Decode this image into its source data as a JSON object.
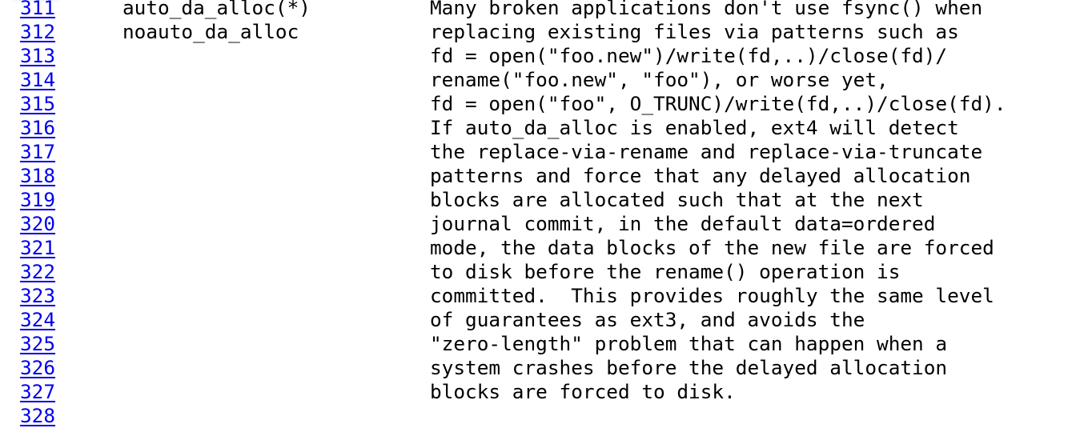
{
  "lines": [
    {
      "number": "311",
      "option": "auto_da_alloc(*)",
      "text": "Many broken applications don't use fsync() when"
    },
    {
      "number": "312",
      "option": "noauto_da_alloc",
      "text": "replacing existing files via patterns such as"
    },
    {
      "number": "313",
      "option": "",
      "text": "fd = open(\"foo.new\")/write(fd,..)/close(fd)/"
    },
    {
      "number": "314",
      "option": "",
      "text": "rename(\"foo.new\", \"foo\"), or worse yet,"
    },
    {
      "number": "315",
      "option": "",
      "text": "fd = open(\"foo\", O_TRUNC)/write(fd,..)/close(fd)."
    },
    {
      "number": "316",
      "option": "",
      "text": "If auto_da_alloc is enabled, ext4 will detect"
    },
    {
      "number": "317",
      "option": "",
      "text": "the replace-via-rename and replace-via-truncate"
    },
    {
      "number": "318",
      "option": "",
      "text": "patterns and force that any delayed allocation"
    },
    {
      "number": "319",
      "option": "",
      "text": "blocks are allocated such that at the next"
    },
    {
      "number": "320",
      "option": "",
      "text": "journal commit, in the default data=ordered"
    },
    {
      "number": "321",
      "option": "",
      "text": "mode, the data blocks of the new file are forced"
    },
    {
      "number": "322",
      "option": "",
      "text": "to disk before the rename() operation is"
    },
    {
      "number": "323",
      "option": "",
      "text": "committed.  This provides roughly the same level"
    },
    {
      "number": "324",
      "option": "",
      "text": "of guarantees as ext3, and avoids the"
    },
    {
      "number": "325",
      "option": "",
      "text": "\"zero-length\" problem that can happen when a"
    },
    {
      "number": "326",
      "option": "",
      "text": "system crashes before the delayed allocation"
    },
    {
      "number": "327",
      "option": "",
      "text": "blocks are forced to disk."
    },
    {
      "number": "328",
      "option": "",
      "text": ""
    }
  ]
}
